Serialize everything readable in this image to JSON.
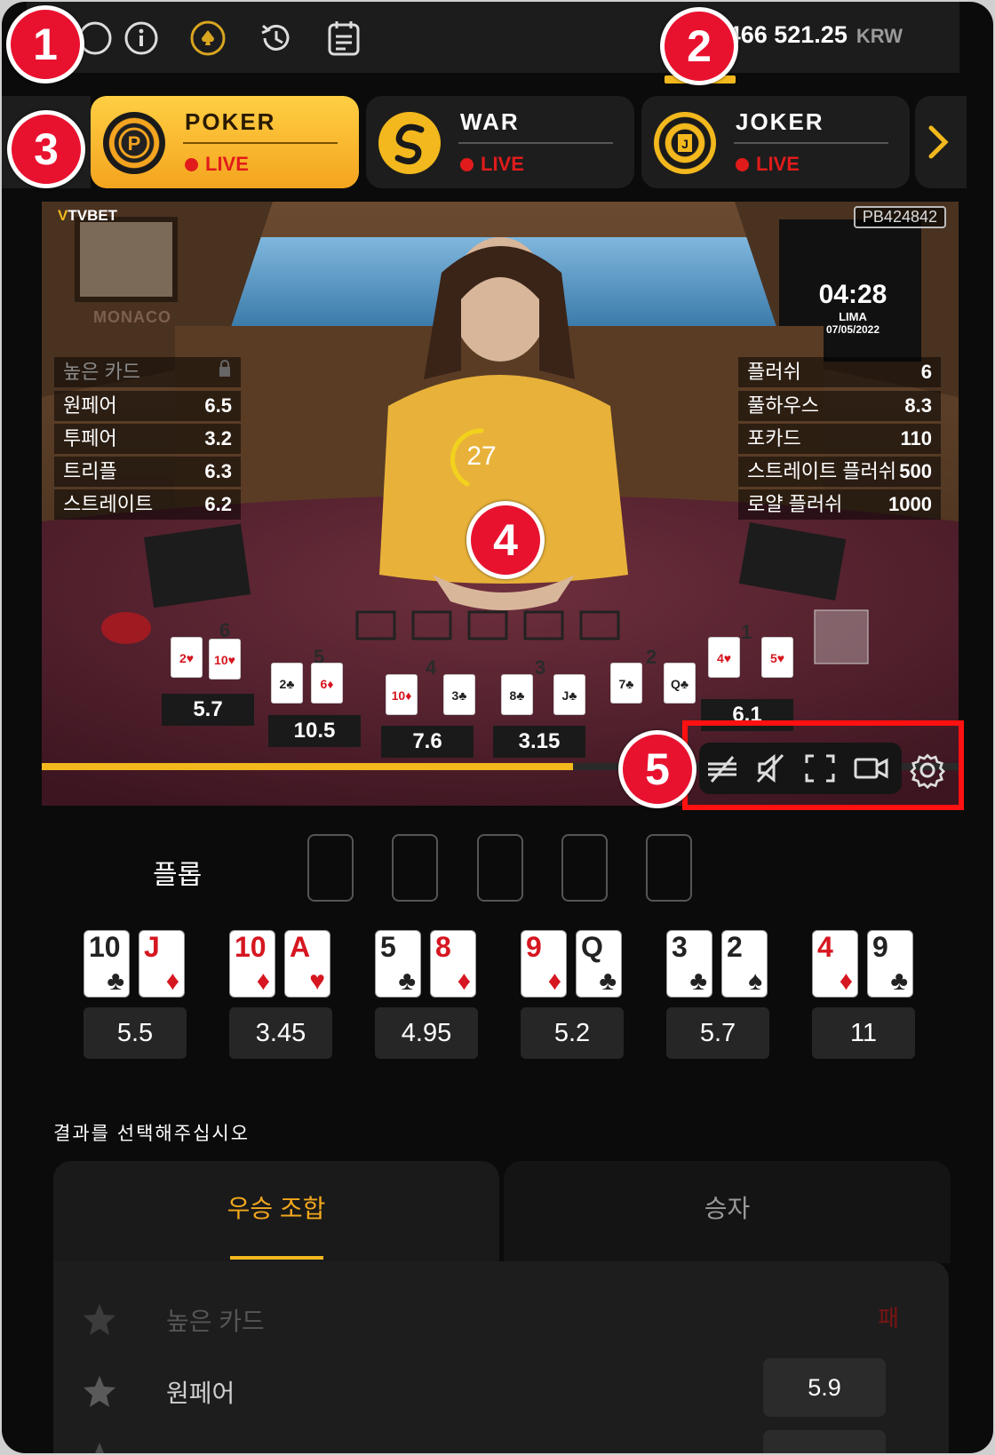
{
  "header": {
    "balance": "1 466 521.25",
    "currency": "KRW"
  },
  "icons": {
    "info": "info-icon",
    "active": "spade-coin-icon",
    "history": "history-icon",
    "results": "notepad-icon"
  },
  "games": [
    {
      "name": "POKER",
      "status": "LIVE",
      "active": true
    },
    {
      "name": "WAR",
      "status": "LIVE",
      "active": false
    },
    {
      "name": "JOKER",
      "status": "LIVE",
      "active": false
    }
  ],
  "video": {
    "brand": "TVBET",
    "round_id": "PB424842",
    "clock": {
      "time": "04:28",
      "city": "LIMA",
      "date": "07/05/2022"
    },
    "board_sign": "MONACO",
    "timer": "27",
    "progress": 0.58,
    "left_odds": [
      {
        "label": "높은 카드",
        "value": ""
      },
      {
        "label": "원페어",
        "value": "6.5"
      },
      {
        "label": "투페어",
        "value": "3.2"
      },
      {
        "label": "트리플",
        "value": "6.3"
      },
      {
        "label": "스트레이트",
        "value": "6.2"
      }
    ],
    "right_odds": [
      {
        "label": "플러쉬",
        "value": "6"
      },
      {
        "label": "풀하우스",
        "value": "8.3"
      },
      {
        "label": "포카드",
        "value": "110"
      },
      {
        "label": "스트레이트 플러쉬",
        "value": "500"
      },
      {
        "label": "로얄 플러쉬",
        "value": "1000"
      }
    ],
    "hand_numbers": [
      "6",
      "5",
      "4",
      "3",
      "2",
      "1"
    ],
    "table_odds": [
      "5.7",
      "10.5",
      "7.6",
      "3.15",
      "6.1"
    ],
    "table_cards": [
      "2♥",
      "10♥",
      "2♣",
      "6♦",
      "10♦",
      "3♣",
      "8♣",
      "J♣",
      "7♣",
      "Q♣",
      "4♥",
      "5♥"
    ]
  },
  "markers": [
    "1",
    "2",
    "3",
    "4",
    "5"
  ],
  "flop": {
    "label": "플롭"
  },
  "hands": [
    {
      "cards": [
        {
          "rank": "10",
          "suit": "♣",
          "color": "blk"
        },
        {
          "rank": "J",
          "suit": "♦",
          "color": "red"
        }
      ],
      "odd": "5.5"
    },
    {
      "cards": [
        {
          "rank": "10",
          "suit": "♦",
          "color": "red"
        },
        {
          "rank": "A",
          "suit": "♥",
          "color": "red"
        }
      ],
      "odd": "3.45"
    },
    {
      "cards": [
        {
          "rank": "5",
          "suit": "♣",
          "color": "blk"
        },
        {
          "rank": "8",
          "suit": "♦",
          "color": "red"
        }
      ],
      "odd": "4.95"
    },
    {
      "cards": [
        {
          "rank": "9",
          "suit": "♦",
          "color": "red"
        },
        {
          "rank": "Q",
          "suit": "♣",
          "color": "blk"
        }
      ],
      "odd": "5.2"
    },
    {
      "cards": [
        {
          "rank": "3",
          "suit": "♣",
          "color": "blk"
        },
        {
          "rank": "2",
          "suit": "♠",
          "color": "blk"
        }
      ],
      "odd": "5.7"
    },
    {
      "cards": [
        {
          "rank": "4",
          "suit": "♦",
          "color": "red"
        },
        {
          "rank": "9",
          "suit": "♣",
          "color": "blk"
        }
      ],
      "odd": "11"
    }
  ],
  "bet": {
    "prompt": "결과를 선택해주십시오",
    "tabs": [
      {
        "label": "우승 조합",
        "active": true
      },
      {
        "label": "승자",
        "active": false
      }
    ],
    "rows": [
      {
        "label": "높은 카드",
        "status": "패",
        "value": ""
      },
      {
        "label": "원페어",
        "status": "",
        "value": "5.9"
      }
    ]
  },
  "colors": {
    "accent": "#f2b81d",
    "live": "#e11b1b",
    "marker": "#e8122f"
  }
}
